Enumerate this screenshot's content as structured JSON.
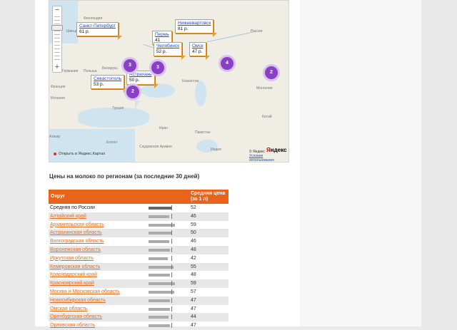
{
  "map": {
    "zoom_in": "+",
    "zoom_out": "−",
    "places": [
      {
        "id": "finland",
        "name": "Финляндия"
      },
      {
        "id": "sweden",
        "name": "Швеция"
      },
      {
        "id": "russia",
        "name": "Россия"
      },
      {
        "id": "germany",
        "name": "Германия"
      },
      {
        "id": "poland",
        "name": "Польша"
      },
      {
        "id": "belarus",
        "name": "Беларусь"
      },
      {
        "id": "kazakhstan",
        "name": "Казахстан"
      },
      {
        "id": "mongolia",
        "name": "Монголия"
      },
      {
        "id": "china",
        "name": "Китай"
      },
      {
        "id": "turkey",
        "name": "Турция"
      },
      {
        "id": "iran",
        "name": "Иран"
      },
      {
        "id": "pakistan",
        "name": "Пакистан"
      },
      {
        "id": "india",
        "name": "Индия"
      },
      {
        "id": "egypt",
        "name": "Египет"
      },
      {
        "id": "saudi",
        "name": "Саудовская Аравия"
      },
      {
        "id": "algeria",
        "name": "Алжир"
      },
      {
        "id": "spain",
        "name": "Испания"
      },
      {
        "id": "france",
        "name": "Франция"
      }
    ],
    "price_labels": [
      {
        "city": "Санкт-Петербург",
        "price": "61 р."
      },
      {
        "city": "Нижневартовск",
        "price": "81 р."
      },
      {
        "city": "Пермь",
        "price": "41"
      },
      {
        "city": "Челябинск",
        "price": "52 р."
      },
      {
        "city": "Омск",
        "price": "47 р."
      },
      {
        "city": "Астрахань",
        "price": "50 р."
      },
      {
        "city": "Севастополь",
        "price": "53 р."
      }
    ],
    "clusters": [
      "3",
      "3",
      "4",
      "2",
      "2"
    ],
    "open_link": "Открыть в Яндекс.Картах",
    "copyright": "© Яндекс",
    "terms": "Условия использования",
    "logo_prefix": "Я",
    "logo_rest": "ндекс"
  },
  "heading": "Цены на молоко по регионам (за последние 30 дней)",
  "table": {
    "col_region": "Округ",
    "col_price": "Средняя цена (за 1 л)",
    "total": {
      "name": "Средняя по России",
      "value": 52
    },
    "rows": [
      {
        "name": "Алтайский край",
        "value": 46
      },
      {
        "name": "Архангельская область",
        "value": 59
      },
      {
        "name": "Астраханская область",
        "value": 50
      },
      {
        "name": "Волгоградская область",
        "value": 46
      },
      {
        "name": "Воронежская область",
        "value": 48
      },
      {
        "name": "Иркутская область",
        "value": 42
      },
      {
        "name": "Кемеровская область",
        "value": 55
      },
      {
        "name": "Краснодарский край",
        "value": 48
      },
      {
        "name": "Красноярский край",
        "value": 59
      },
      {
        "name": "Москва и Московская область",
        "value": 57
      },
      {
        "name": "Новосибирская область",
        "value": 47
      },
      {
        "name": "Омская область",
        "value": 47
      },
      {
        "name": "Оренбургская область",
        "value": 44
      },
      {
        "name": "Орловская область",
        "value": 47
      }
    ]
  },
  "colors": {
    "accent": "#e8641c",
    "link": "#e26c1e",
    "cluster": "#8a3fc7",
    "label_border": "#e09a2f"
  }
}
